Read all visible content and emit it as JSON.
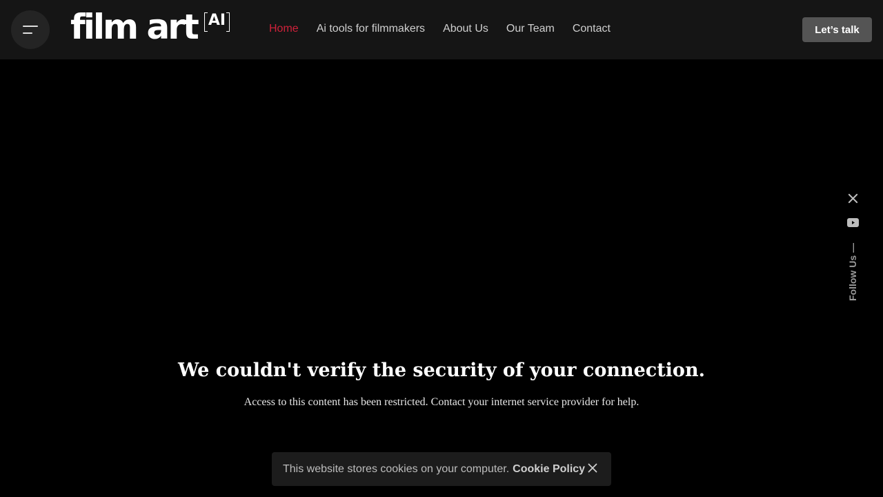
{
  "brand": {
    "logo_text": "film art",
    "logo_badge": "AI"
  },
  "header": {
    "menu_icon": "hamburger-menu-icon",
    "nav": [
      {
        "label": "Home",
        "active": true
      },
      {
        "label": "Ai tools for filmmakers",
        "active": false
      },
      {
        "label": "About Us",
        "active": false
      },
      {
        "label": "Our Team",
        "active": false
      },
      {
        "label": "Contact",
        "active": false
      }
    ],
    "cta_label": "Let’s talk"
  },
  "social": {
    "icons": [
      "x-twitter-icon",
      "youtube-icon"
    ],
    "follow_label": "Follow Us —"
  },
  "error": {
    "title": "We couldn't verify the security of your connection.",
    "message": "Access to this content has been restricted. Contact your internet service provider for help."
  },
  "cookie_banner": {
    "text": "This website stores cookies on your computer.",
    "link_label": "Cookie Policy",
    "close_icon": "close-icon"
  },
  "colors": {
    "accent": "#d0213a",
    "header_bg": "#151515",
    "page_bg": "#000000",
    "cta_bg": "#545454"
  }
}
